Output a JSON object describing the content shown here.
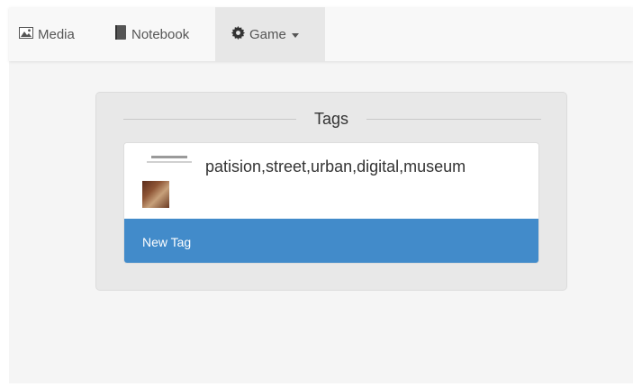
{
  "navbar": {
    "items": [
      {
        "label": "Media",
        "icon": "picture-icon"
      },
      {
        "label": "Notebook",
        "icon": "book-icon"
      },
      {
        "label": "Game",
        "icon": "gear-icon",
        "active": true,
        "has_dropdown": true
      }
    ]
  },
  "panel": {
    "title": "Tags",
    "items": [
      {
        "text": "patision,street,urban,digital,museum",
        "thumbnail": "tag-thumbnail"
      }
    ],
    "new_tag_label": "New Tag"
  },
  "colors": {
    "accent": "#428bca",
    "navbar_bg": "#f8f8f8",
    "active_tab_bg": "#e7e7e7",
    "panel_bg": "#e8e8e8"
  }
}
